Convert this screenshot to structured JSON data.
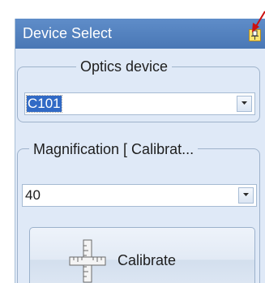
{
  "panel": {
    "title": "Device Select",
    "pin_icon": "pin-icon"
  },
  "optics": {
    "legend": "Optics device",
    "value": "C101",
    "dropdown_icon": "chevron-down-icon"
  },
  "magnification": {
    "legend": "Magnification [ Calibrat...",
    "value": "40",
    "dropdown_icon": "chevron-down-icon"
  },
  "calibrate": {
    "label": "Calibrate",
    "icon": "ruler-icon"
  },
  "colors": {
    "titlebar": "#4f7fbf",
    "panel_bg": "#dfe9f7",
    "selection": "#316ac5",
    "annotation_arrow": "#cc1111"
  }
}
